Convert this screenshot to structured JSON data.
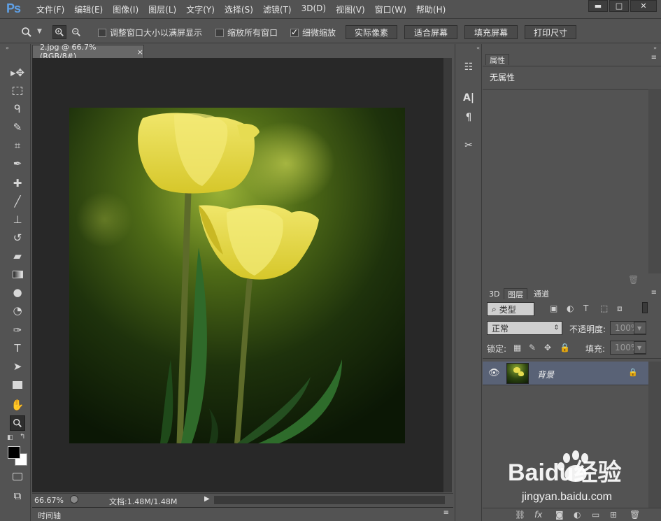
{
  "app": {
    "logo": "Ps"
  },
  "menu": {
    "items": [
      "文件(F)",
      "编辑(E)",
      "图像(I)",
      "图层(L)",
      "文字(Y)",
      "选择(S)",
      "滤镜(T)",
      "3D(D)",
      "视图(V)",
      "窗口(W)",
      "帮助(H)"
    ]
  },
  "window_controls": {
    "minimize": "▬",
    "maximize": "□",
    "close": "✕"
  },
  "options": {
    "resize_windows": "调整窗口大小以满屏显示",
    "zoom_all": "缩放所有窗口",
    "scrubby_zoom": "细微缩放",
    "buttons": [
      "实际像素",
      "适合屏幕",
      "填充屏幕",
      "打印尺寸"
    ]
  },
  "document": {
    "tab_title": "2.jpg @ 66.7%(RGB/8#)",
    "tab_close": "×",
    "zoom_level": "66.67%",
    "doc_info": "文档:1.48M/1.48M"
  },
  "timeline": {
    "label": "时间轴"
  },
  "properties": {
    "tab": "属性",
    "content": "无属性"
  },
  "layers": {
    "tabs": [
      "3D",
      "图层",
      "通道"
    ],
    "filter_label": "类型",
    "blend_mode": "正常",
    "opacity_label": "不透明度:",
    "opacity_value": "100%",
    "lock_label": "锁定:",
    "fill_label": "填充:",
    "fill_value": "100%",
    "layer_name": "背景"
  },
  "watermark": {
    "brand": "Baidu经验",
    "url": "jingyan.baidu.com"
  }
}
